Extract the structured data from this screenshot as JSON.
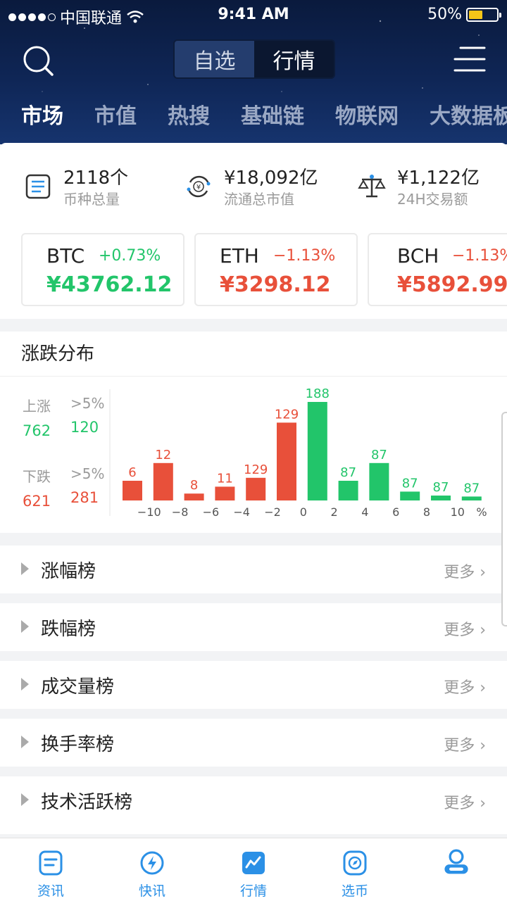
{
  "status_bar": {
    "carrier": "中国联通",
    "time": "9:41 AM",
    "battery": "50%"
  },
  "header": {
    "segments": [
      {
        "label": "自选",
        "active": false
      },
      {
        "label": "行情",
        "active": true
      }
    ],
    "tabs": [
      "市场",
      "市值",
      "热搜",
      "基础链",
      "物联网",
      "大数据板"
    ]
  },
  "stats": [
    {
      "value": "2118个",
      "label": "币种总量",
      "icon": "list-icon"
    },
    {
      "value": "¥18,092亿",
      "label": "流通总市值",
      "icon": "yuan-cycle-icon"
    },
    {
      "value": "¥1,122亿",
      "label": "24H交易额",
      "icon": "scale-icon"
    }
  ],
  "coins": [
    {
      "name": "BTC",
      "change": "+0.73%",
      "price": "¥43762.12",
      "trend": "up"
    },
    {
      "name": "ETH",
      "change": "−1.13%",
      "price": "¥3298.12",
      "trend": "down"
    },
    {
      "name": "BCH",
      "change": "−1.13%",
      "price": "¥5892.99",
      "trend": "down"
    }
  ],
  "distribution": {
    "title": "涨跌分布",
    "up_label": "上涨",
    "up_gt5_label": ">5%",
    "up_count": "762",
    "up_gt5": "120",
    "down_label": "下跌",
    "down_gt5_label": ">5%",
    "down_count": "621",
    "down_gt5": "281"
  },
  "chart_data": {
    "type": "bar",
    "categories": [
      "≤-10",
      "-10~-8",
      "-8~-6",
      "-6~-4",
      "-4~-2",
      "-2~0",
      "0~2",
      "2~4",
      "4~6",
      "6~8",
      "8~10",
      ">10"
    ],
    "values": [
      6,
      12,
      8,
      11,
      129,
      129,
      188,
      87,
      87,
      87,
      87,
      87
    ],
    "colors": [
      "#e8503a",
      "#e8503a",
      "#e8503a",
      "#e8503a",
      "#e8503a",
      "#e8503a",
      "#22c56a",
      "#22c56a",
      "#22c56a",
      "#22c56a",
      "#22c56a",
      "#22c56a"
    ],
    "x_ticks": [
      "−10",
      "−8",
      "−6",
      "−4",
      "−2",
      "0",
      "2",
      "4",
      "6",
      "8",
      "10"
    ],
    "x_unit": "%",
    "bar_levels": [
      0.2,
      0.38,
      0.07,
      0.14,
      0.23,
      0.79,
      1.0,
      0.2,
      0.38,
      0.09,
      0.05,
      0.04
    ]
  },
  "lists": [
    {
      "label": "涨幅榜",
      "more": "更多 ›"
    },
    {
      "label": "跌幅榜",
      "more": "更多 ›"
    },
    {
      "label": "成交量榜",
      "more": "更多 ›"
    },
    {
      "label": "换手率榜",
      "more": "更多 ›"
    },
    {
      "label": "技术活跃榜",
      "more": "更多 ›"
    }
  ],
  "nav": [
    {
      "label": "资讯",
      "icon": "news-icon"
    },
    {
      "label": "快讯",
      "icon": "flash-icon"
    },
    {
      "label": "行情",
      "icon": "market-icon"
    },
    {
      "label": "选币",
      "icon": "compass-icon"
    },
    {
      "label": "",
      "icon": "profile-icon"
    }
  ],
  "colors": {
    "up": "#22c56a",
    "down": "#e8503a",
    "accent": "#2b90e6",
    "header_bg": "#0f2656"
  }
}
